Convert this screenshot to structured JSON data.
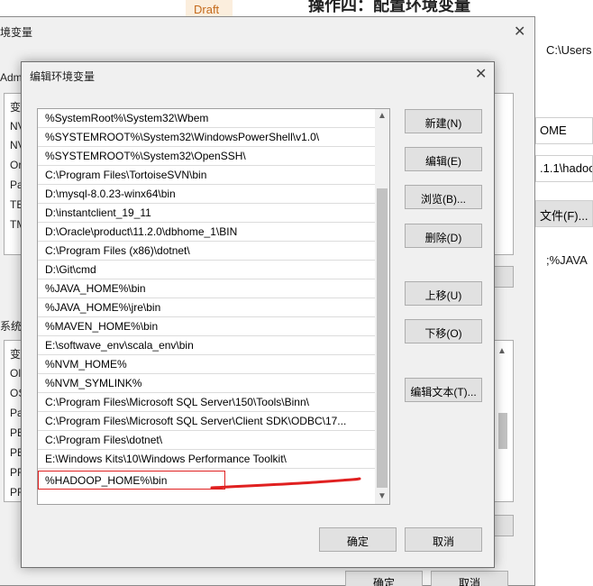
{
  "background": {
    "draft_tag": "Draft",
    "heading": "操作四：配置环境变量",
    "path_text": "C:\\Users",
    "field_ome": "OME",
    "field_hadoop": ".1.1\\hadoo",
    "file_button": "文件(F)...",
    "java_text": ";%JAVA"
  },
  "outer_dialog": {
    "title": "境变量",
    "admin_label": "Adm",
    "user_vars": [
      "变",
      "NV",
      "NV",
      "Or",
      "Pa",
      "TE",
      "TM"
    ],
    "system_label": "系统",
    "system_vars": [
      "变",
      "Ol",
      "OS",
      "Pa",
      "PE",
      "PE",
      "PR",
      "PR"
    ],
    "ok_label": "确定",
    "cancel_label": "取消"
  },
  "inner_dialog": {
    "title": "编辑环境变量",
    "paths": [
      "%SystemRoot%\\System32\\Wbem",
      "%SYSTEMROOT%\\System32\\WindowsPowerShell\\v1.0\\",
      "%SYSTEMROOT%\\System32\\OpenSSH\\",
      "C:\\Program Files\\TortoiseSVN\\bin",
      "D:\\mysql-8.0.23-winx64\\bin",
      "D:\\instantclient_19_11",
      "D:\\Oracle\\product\\11.2.0\\dbhome_1\\BIN",
      "C:\\Program Files (x86)\\dotnet\\",
      "D:\\Git\\cmd",
      "%JAVA_HOME%\\bin",
      "%JAVA_HOME%\\jre\\bin",
      "%MAVEN_HOME%\\bin",
      "E:\\softwave_env\\scala_env\\bin",
      "%NVM_HOME%",
      "%NVM_SYMLINK%",
      "C:\\Program Files\\Microsoft SQL Server\\150\\Tools\\Binn\\",
      "C:\\Program Files\\Microsoft SQL Server\\Client SDK\\ODBC\\17...",
      "C:\\Program Files\\dotnet\\",
      "E:\\Windows Kits\\10\\Windows Performance Toolkit\\",
      "%HADOOP_HOME%\\bin"
    ],
    "buttons": {
      "new": "新建(N)",
      "edit": "编辑(E)",
      "browse": "浏览(B)...",
      "delete": "删除(D)",
      "move_up": "上移(U)",
      "move_down": "下移(O)",
      "edit_text": "编辑文本(T)...",
      "ok": "确定",
      "cancel": "取消"
    },
    "highlight_color": "#e02020"
  }
}
